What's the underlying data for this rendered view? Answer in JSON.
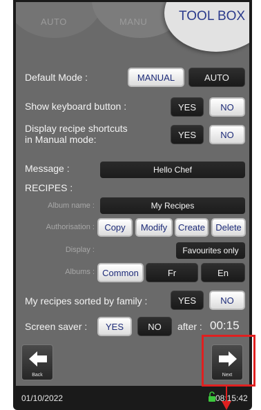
{
  "tabs": {
    "auto": "AUTO",
    "manu": "MANU",
    "toolbox": "TOOL BOX"
  },
  "default_mode": {
    "label": "Default Mode :",
    "manual": "MANUAL",
    "auto": "AUTO",
    "selected": "MANUAL"
  },
  "keyboard": {
    "label": "Show keyboard button :",
    "yes": "YES",
    "no": "NO",
    "selected": "NO"
  },
  "shortcuts": {
    "label_line1": "Display recipe shortcuts",
    "label_line2": "in Manual mode:",
    "yes": "YES",
    "no": "NO",
    "selected": "NO"
  },
  "message": {
    "label": "Message :",
    "value": "Hello Chef"
  },
  "recipes": {
    "heading": "RECIPES :",
    "album_name_label": "Album name :",
    "album_name_value": "My Recipes",
    "authorisation_label": "Authorisation :",
    "auth_buttons": [
      "Copy",
      "Modify",
      "Create",
      "Delete"
    ],
    "display_label": "Display :",
    "display_value": "Favourites only",
    "albums_label": "Albums :",
    "albums": [
      "Common",
      "Fr",
      "En"
    ],
    "albums_selected": "Common"
  },
  "sorted": {
    "label": "My recipes sorted by family :",
    "yes": "YES",
    "no": "NO",
    "selected": "NO"
  },
  "screen_saver": {
    "label": "Screen saver :",
    "yes": "YES",
    "no": "NO",
    "selected": "YES",
    "after_label": "after :",
    "after_value": "00:15"
  },
  "nav": {
    "back": "Back",
    "next": "Next"
  },
  "footer": {
    "date": "01/10/2022",
    "time": "08:15:42"
  },
  "colors": {
    "accent_text": "#1c2a78",
    "highlight": "#e02020",
    "lock": "#3cc83c"
  }
}
